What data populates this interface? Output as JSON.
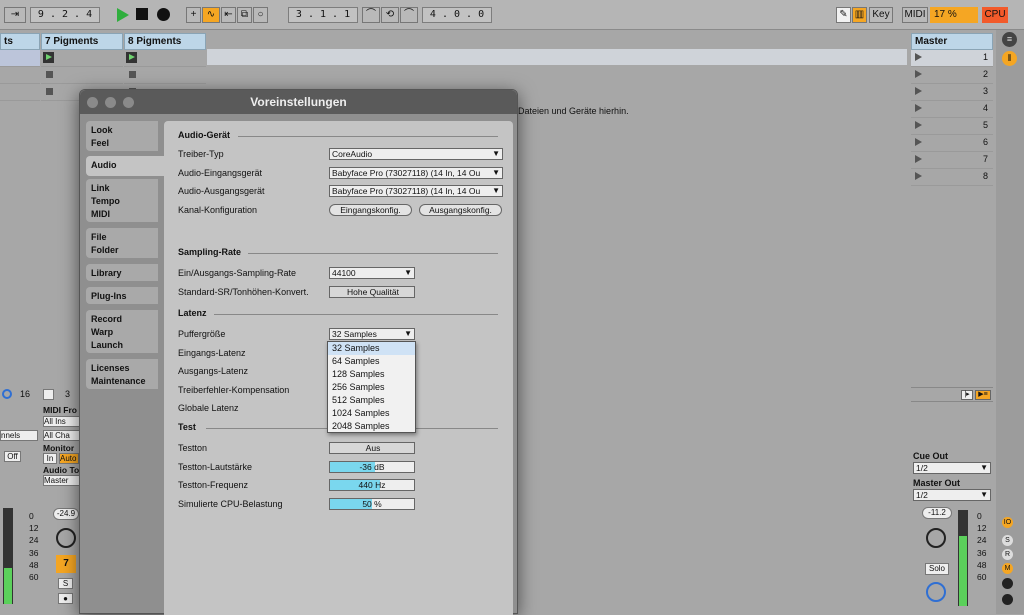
{
  "transport": {
    "tempo_icon": "tap-arrows-icon",
    "signature": "9 . 2 . 4",
    "position": "3 . 1 . 1",
    "loop_length": "4 . 0 . 0",
    "key_label": "Key",
    "midi_label": "MIDI",
    "cpu_value": "17 %",
    "cpu_label": "CPU"
  },
  "tracks": [
    {
      "name": "ts"
    },
    {
      "name": "7 Pigments"
    },
    {
      "name": "8 Pigments"
    }
  ],
  "master": {
    "name": "Master",
    "scenes": [
      "1",
      "2",
      "3",
      "4",
      "5",
      "6",
      "7",
      "8"
    ]
  },
  "browser_hint": "Dateien und Geräte hierhin.",
  "mixer": {
    "left_num": "16",
    "mid_num": "3",
    "midi_from": "MIDI Fro",
    "all_ins": "All Ins",
    "all_channels_a": "nnels",
    "all_channels_b": "All Cha",
    "monitor": "Monitor",
    "in_label": "In",
    "auto_label": "Auto",
    "off_label": "Off",
    "audio_to": "Audio To",
    "master_route": "Master",
    "vol_track": "-24.9",
    "track_num": "7",
    "solo_s": "S",
    "scale": [
      "0",
      "12",
      "24",
      "36",
      "48",
      "60"
    ],
    "cue_out": "Cue Out",
    "cue_val": "1/2",
    "master_out": "Master Out",
    "master_out_val": "1/2",
    "master_vol": "-11.2",
    "solo_label": "Solo"
  },
  "dialog": {
    "title": "Voreinstellungen",
    "tabs": [
      "Look\nFeel",
      "Audio",
      "Link\nTempo\nMIDI",
      "File\nFolder",
      "Library",
      "Plug-Ins",
      "Record\nWarp\nLaunch",
      "Licenses\nMaintenance"
    ],
    "sections": {
      "audio_device": "Audio-Gerät",
      "sampling_rate": "Sampling-Rate",
      "latency": "Latenz",
      "test": "Test"
    },
    "labels": {
      "driver_type": "Treiber-Typ",
      "input_device": "Audio-Eingangsgerät",
      "output_device": "Audio-Ausgangsgerät",
      "channel_config": "Kanal-Konfiguration",
      "io_sample_rate": "Ein/Ausgangs-Sampling-Rate",
      "default_src": "Standard-SR/Tonhöhen-Konvert.",
      "buffer_size": "Puffergröße",
      "input_latency": "Eingangs-Latenz",
      "output_latency": "Ausgangs-Latenz",
      "driver_error_comp": "Treiberfehler-Kompensation",
      "overall_latency": "Globale Latenz",
      "test_tone": "Testton",
      "test_tone_volume": "Testton-Lautstärke",
      "test_tone_freq": "Testton-Frequenz",
      "sim_cpu": "Simulierte CPU-Belastung"
    },
    "values": {
      "driver_type": "CoreAudio",
      "input_device": "Babyface Pro (73027118) (14 In, 14 Ou",
      "output_device": "Babyface Pro (73027118) (14 In, 14 Ou",
      "input_config_btn": "Eingangskonfig.",
      "output_config_btn": "Ausgangskonfig.",
      "io_sample_rate": "44100",
      "default_src": "Hohe Qualität",
      "buffer_size": "32 Samples",
      "test_tone": "Aus",
      "test_tone_volume": "-36 dB",
      "test_tone_freq": "440 Hz",
      "sim_cpu": "50 %"
    },
    "buffer_options": [
      "32 Samples",
      "64 Samples",
      "128 Samples",
      "256 Samples",
      "512 Samples",
      "1024 Samples",
      "2048 Samples"
    ],
    "buffer_selected_index": 0
  },
  "colors": {
    "accent_orange": "#f5a623",
    "accent_cyan": "#7ad7ee",
    "track_header": "#bdd6e8",
    "play_green": "#6fd36f"
  }
}
